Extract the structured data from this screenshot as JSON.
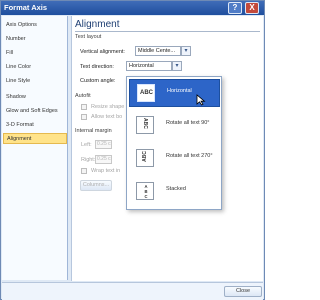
{
  "window": {
    "title": "Format Axis",
    "help_label": "?",
    "close_label": "X"
  },
  "sidebar": {
    "items": [
      {
        "label": "Axis Options"
      },
      {
        "label": "Number"
      },
      {
        "label": "Fill"
      },
      {
        "label": "Line Color"
      },
      {
        "label": "Line Style"
      },
      {
        "label": "Shadow"
      },
      {
        "label": "Glow and Soft Edges"
      },
      {
        "label": "3-D Format"
      },
      {
        "label": "Alignment",
        "selected": true
      }
    ]
  },
  "panel": {
    "heading": "Alignment",
    "text_layout": {
      "section_label": "Text layout",
      "vertical_alignment_label": "Vertical alignment:",
      "vertical_alignment_value": "Middle Cente...",
      "text_direction_label": "Text direction:",
      "text_direction_value": "Horizontal",
      "custom_angle_label": "Custom angle:"
    },
    "autofit": {
      "section_label": "Autofit",
      "resize_shape_label": "Resize shape",
      "allow_text_label": "Allow text bo"
    },
    "internal_margin": {
      "section_label": "Internal margin",
      "left_label": "Left:",
      "left_value": "0.25 c",
      "right_label": "Right:",
      "right_value": "0.25 c",
      "wrap_label": "Wrap text in",
      "columns_button": "Columns..."
    }
  },
  "dropdown": {
    "options": [
      {
        "icon_text": "ABC",
        "label": "Horizontal",
        "selected": true
      },
      {
        "icon_text": "ABC",
        "label": "Rotate all text 90°"
      },
      {
        "icon_text": "ABC",
        "label": "Rotate all text 270°"
      },
      {
        "icon_text": "A\nB\nC",
        "label": "Stacked"
      }
    ]
  },
  "footer": {
    "close_button": "Close"
  },
  "colors": {
    "title_bar": "#2a58a7",
    "selected_sidebar": "#ffe38a",
    "selected_option": "#2d65c8"
  }
}
